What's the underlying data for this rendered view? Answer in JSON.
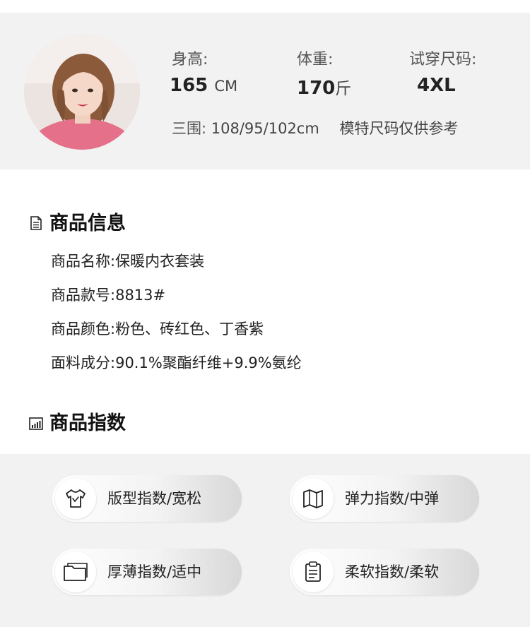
{
  "model": {
    "height_label": "身高:",
    "height_value": "165",
    "height_unit": "CM",
    "weight_label": "体重:",
    "weight_value": "170",
    "weight_unit": "斤",
    "size_label": "试穿尺码:",
    "size_value": "4XL",
    "measurements_label": "三围:",
    "measurements_value": "108/95/102cm",
    "note": "模特尺码仅供参考"
  },
  "product_info": {
    "title": "商品信息",
    "rows": [
      {
        "label": "商品名称:",
        "value": "保暖内衣套装"
      },
      {
        "label": "商品款号:",
        "value": "8813#"
      },
      {
        "label": "商品颜色:",
        "value": "粉色、砖红色、丁香紫"
      },
      {
        "label": "面料成分:",
        "value": "90.1%聚酯纤维+9.9%氨纶"
      }
    ]
  },
  "product_index": {
    "title": "商品指数",
    "items": [
      {
        "label": "版型指数/宽松",
        "icon": "tshirt-icon"
      },
      {
        "label": "弹力指数/中弹",
        "icon": "map-fold-icon"
      },
      {
        "label": "厚薄指数/适中",
        "icon": "folder-icon"
      },
      {
        "label": "柔软指数/柔软",
        "icon": "clipboard-icon"
      }
    ]
  }
}
